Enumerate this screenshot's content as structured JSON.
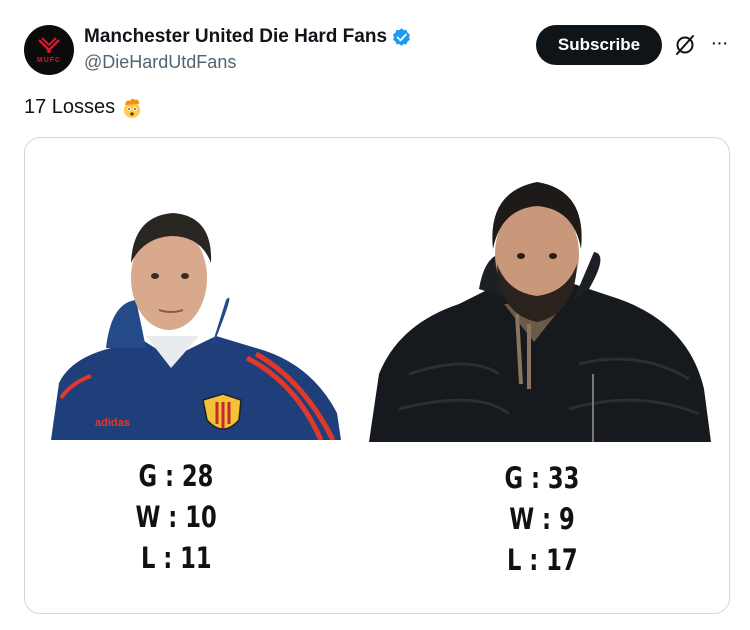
{
  "account": {
    "display_name": "Manchester United Die Hard Fans",
    "handle": "@DieHardUtdFans",
    "avatar_text": "MUFC",
    "verified": true
  },
  "actions": {
    "subscribe_label": "Subscribe",
    "grok_icon": "grok-icon",
    "more_icon": "more-options-icon",
    "more_glyph": "···"
  },
  "tweet": {
    "text": "17 Losses",
    "emoji": "exploding-head-emoji"
  },
  "media": {
    "left_stats": {
      "games": "G : 28",
      "wins": "W : 10",
      "losses": "L : 11"
    },
    "right_stats": {
      "games": "G : 33",
      "wins": "W : 9",
      "losses": "L : 17"
    }
  },
  "colors": {
    "text_primary": "#0f1419",
    "text_secondary": "#536471",
    "verified_blue": "#1d9bf0",
    "button_bg": "#0f1419",
    "border": "#cfd9de"
  }
}
